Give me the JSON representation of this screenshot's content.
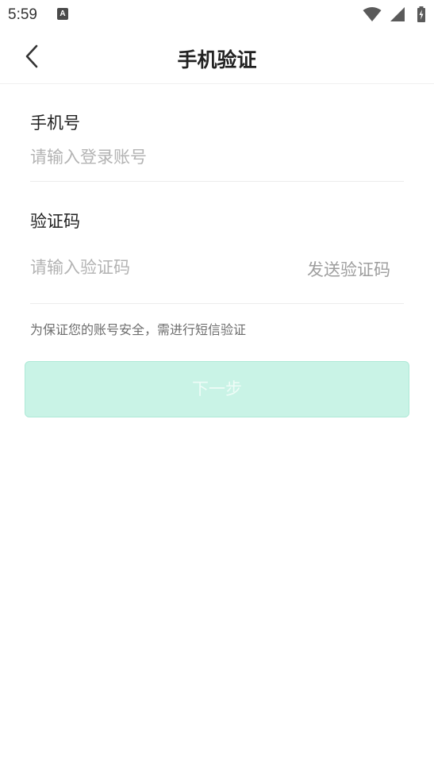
{
  "status_bar": {
    "time": "5:59",
    "notification_icon": "A"
  },
  "header": {
    "title": "手机验证",
    "back_icon": "chevron-left-icon"
  },
  "phone": {
    "label": "手机号",
    "placeholder": "请输入登录账号",
    "value": ""
  },
  "code": {
    "label": "验证码",
    "placeholder": "请输入验证码",
    "value": "",
    "send_label": "发送验证码"
  },
  "hint": "为保证您的账号安全，需进行短信验证",
  "next_button": {
    "label": "下一步",
    "background": "#c9f3e6",
    "text_color": "#eefcf7"
  }
}
